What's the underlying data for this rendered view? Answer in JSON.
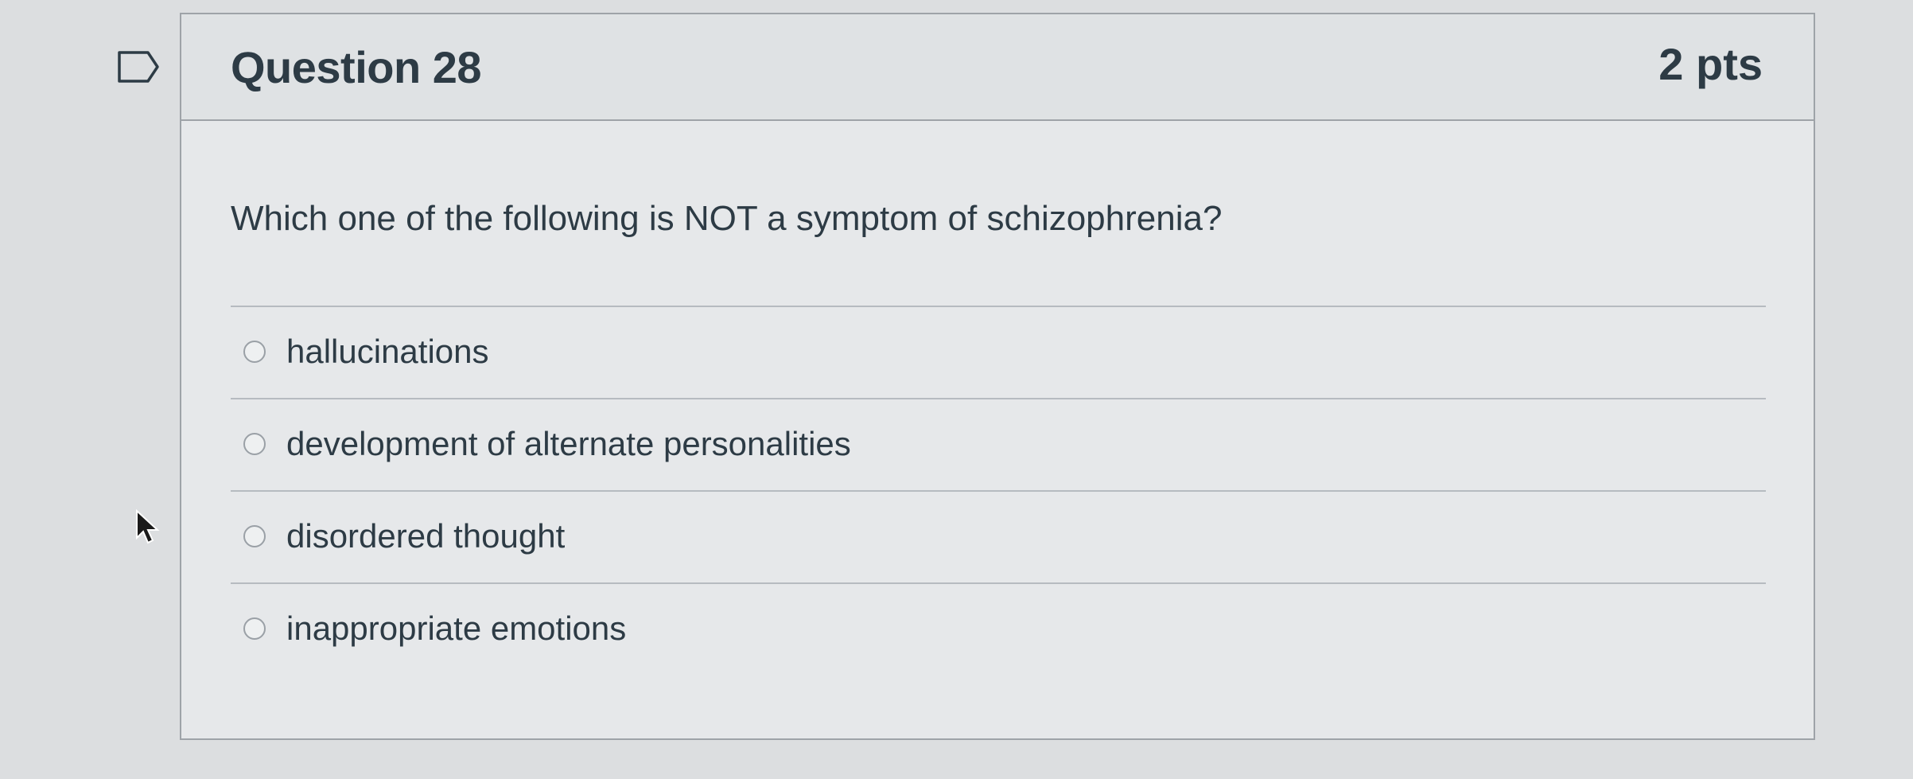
{
  "question": {
    "title": "Question 28",
    "points": "2 pts",
    "prompt": "Which one of the following is NOT a symptom of schizophrenia?",
    "answers": [
      {
        "label": "hallucinations"
      },
      {
        "label": "development of alternate personalities"
      },
      {
        "label": "disordered thought"
      },
      {
        "label": "inappropriate emotions"
      }
    ]
  },
  "icons": {
    "flag": "flag-question-icon",
    "cursor": "mouse-pointer-icon"
  },
  "colors": {
    "text": "#2d3b45",
    "border": "#9ea3a8",
    "header_bg": "#dfe2e4"
  }
}
